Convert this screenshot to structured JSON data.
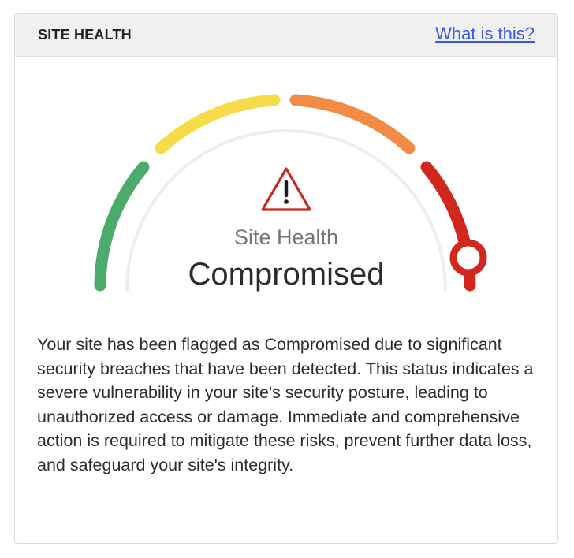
{
  "panel": {
    "title": "SITE HEALTH",
    "help_link": "What is this?"
  },
  "gauge": {
    "label": "Site Health",
    "status": "Compromised",
    "level": 1.0,
    "segments": [
      {
        "name": "green",
        "color": "#4aab6b"
      },
      {
        "name": "yellow",
        "color": "#f7dc4a"
      },
      {
        "name": "orange",
        "color": "#f28c45"
      },
      {
        "name": "red",
        "color": "#d1271d"
      }
    ],
    "track_color": "#eeeeee",
    "icon": "warning-triangle-icon"
  },
  "description": "Your site has been flagged as Compromised due to significant security breaches that have been detected. This status indicates a severe vulnerability in your site's security posture, leading to unauthorized access or damage. Immediate and comprehensive action is required to mitigate these risks, prevent further data loss, and safeguard your site's integrity."
}
